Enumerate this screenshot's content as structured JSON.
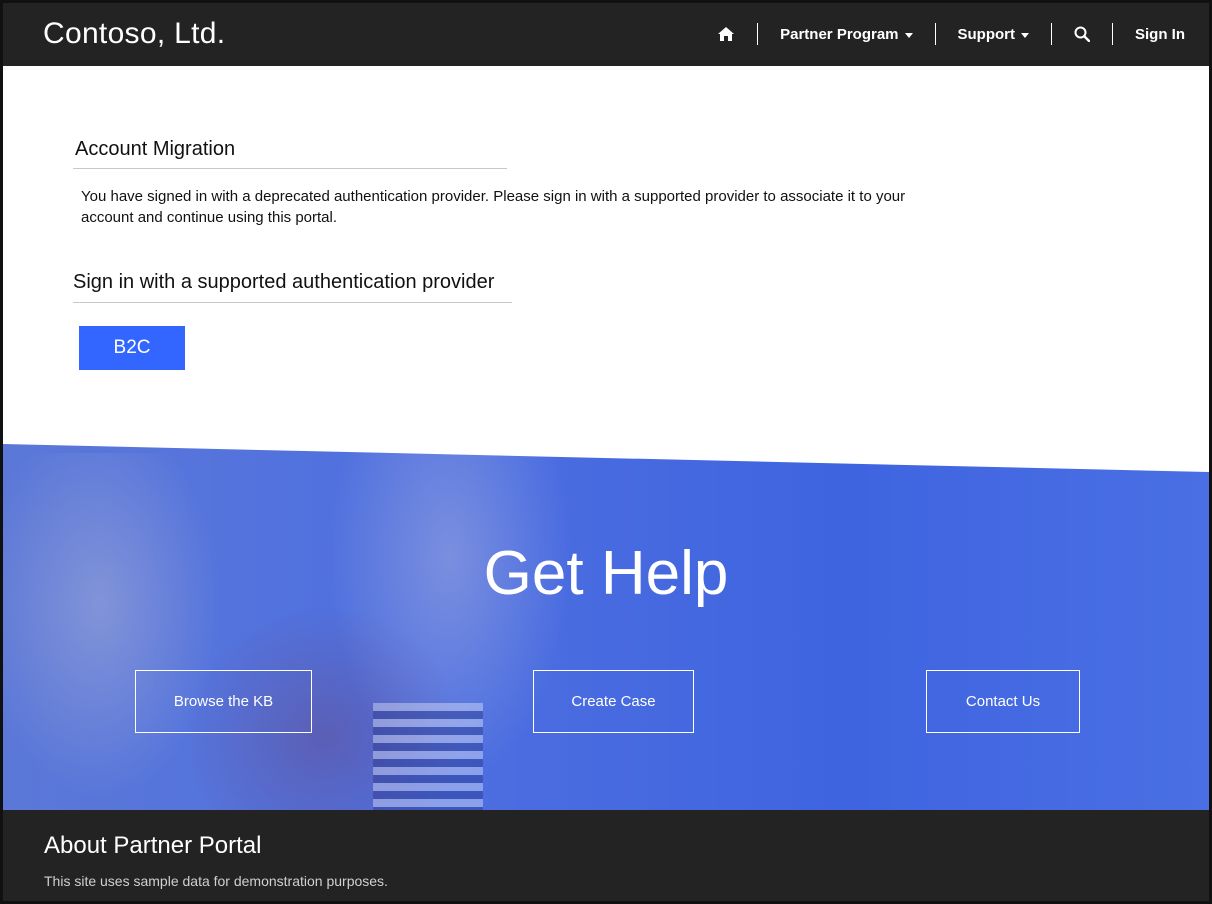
{
  "header": {
    "brand": "Contoso, Ltd.",
    "nav": {
      "home_icon": "home-icon",
      "partner_program": "Partner Program",
      "support": "Support",
      "search_icon": "search-icon",
      "sign_in": "Sign In"
    }
  },
  "main": {
    "migration_heading": "Account Migration",
    "migration_text": "You have signed in with a deprecated authentication provider.  Please sign in with a supported provider to associate it to your account and continue using this portal.",
    "provider_heading": "Sign in with a supported authentication provider",
    "provider_button": "B2C"
  },
  "help": {
    "title": "Get Help",
    "buttons": {
      "browse_kb": "Browse the KB",
      "create_case": "Create Case",
      "contact_us": "Contact Us"
    }
  },
  "footer": {
    "title": "About Partner Portal",
    "text": "This site uses sample data for demonstration purposes."
  },
  "colors": {
    "header_bg": "#232323",
    "accent": "#3366ff",
    "help_band": "#4a6ee0"
  }
}
